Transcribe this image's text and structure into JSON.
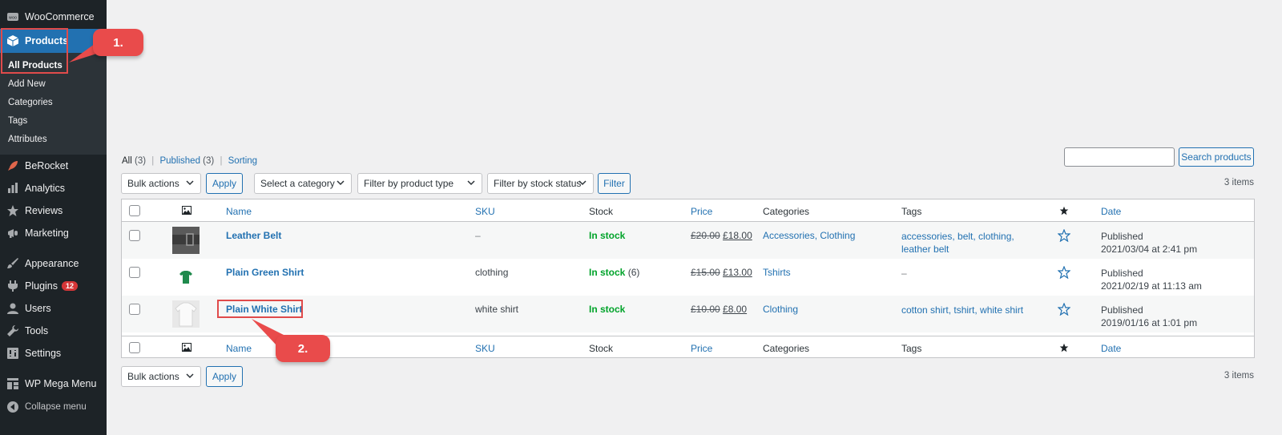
{
  "sidebar": {
    "woocommerce": "WooCommerce",
    "products": "Products",
    "submenu": [
      "All Products",
      "Add New",
      "Categories",
      "Tags",
      "Attributes"
    ],
    "berocket": "BeRocket",
    "analytics": "Analytics",
    "reviews": "Reviews",
    "marketing": "Marketing",
    "appearance": "Appearance",
    "plugins": "Plugins",
    "plugins_badge": "12",
    "users": "Users",
    "tools": "Tools",
    "settings": "Settings",
    "wp_mega_menu": "WP Mega Menu",
    "collapse": "Collapse menu"
  },
  "callouts": {
    "first": "1.",
    "second": "2."
  },
  "views": {
    "all": "All",
    "all_count": "(3)",
    "published": "Published",
    "published_count": "(3)",
    "sorting": "Sorting",
    "sep": "|"
  },
  "search": {
    "button": "Search products",
    "value": ""
  },
  "toolbar": {
    "bulk_actions": "Bulk actions",
    "apply": "Apply",
    "category": "Select a category",
    "product_type": "Filter by product type",
    "stock_status": "Filter by stock status",
    "filter": "Filter",
    "items": "3 items"
  },
  "columns": {
    "name": "Name",
    "sku": "SKU",
    "stock": "Stock",
    "price": "Price",
    "categories": "Categories",
    "tags": "Tags",
    "date": "Date"
  },
  "products": [
    {
      "name": "Leather Belt",
      "sku": "–",
      "stock": "In stock",
      "stock_count": "",
      "price_old": "£20.00",
      "price_new": "£18.00",
      "categories": "Accessories, Clothing",
      "tags_line1": "accessories, belt, clothing,",
      "tags_line2": "leather belt",
      "status": "Published",
      "date": "2021/03/04 at 2:41 pm"
    },
    {
      "name": "Plain Green Shirt",
      "sku": "clothing",
      "stock": "In stock",
      "stock_count": "(6)",
      "price_old": "£15.00",
      "price_new": "£13.00",
      "categories": "Tshirts",
      "tags_line1": "–",
      "tags_line2": "",
      "status": "Published",
      "date": "2021/02/19 at 11:13 am"
    },
    {
      "name": "Plain White Shirt",
      "sku": "white shirt",
      "stock": "In stock",
      "stock_count": "",
      "price_old": "£10.00",
      "price_new": "£8.00",
      "categories": "Clothing",
      "tags_line1": "cotton shirt, tshirt, white shirt",
      "tags_line2": "",
      "status": "Published",
      "date": "2019/01/16 at 1:01 pm"
    }
  ],
  "colors": {
    "admin_bar": "#1d2327",
    "accent": "#2271b1",
    "in_stock": "#00a32a",
    "callout": "#e94b4b"
  },
  "icons": {
    "woocommerce": "woo-icon",
    "products": "box-icon",
    "berocket": "rocket-icon",
    "analytics": "bar-chart-icon",
    "reviews": "star-icon",
    "marketing": "megaphone-icon",
    "appearance": "brush-icon",
    "plugins": "plug-icon",
    "users": "user-icon",
    "tools": "wrench-icon",
    "settings": "settings-icon",
    "mega_menu": "menu-grid-icon",
    "collapse": "collapse-icon"
  }
}
